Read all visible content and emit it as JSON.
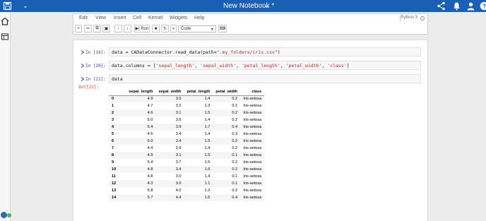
{
  "topbar": {
    "title": "New Notebook *",
    "bg_color": "#1b5fb4"
  },
  "menu": {
    "items": [
      "Edit",
      "View",
      "Insert",
      "Cell",
      "Kernel",
      "Widgets",
      "Help"
    ],
    "kernel": "Python 3"
  },
  "toolbar": {
    "run_label": "Run",
    "cell_type": "Code",
    "icons": [
      "add-cell-icon",
      "cut-icon",
      "copy-icon",
      "paste-icon",
      "move-up-icon",
      "move-down-icon",
      "run-icon",
      "stop-icon",
      "restart-icon",
      "fast-forward-icon",
      "keyboard-icon"
    ]
  },
  "cells": [
    {
      "prompt": "In [16]:",
      "code_parts": [
        "data = CADataConnector.read_data(path=",
        "\".my_folders/iris.csv\"",
        ")"
      ]
    },
    {
      "prompt": "In [20]:",
      "code_parts": [
        "data.columns = [",
        "'sepal_length'",
        ", ",
        "'sepal_width'",
        ", ",
        "'petal_length'",
        ", ",
        "'petal_width'",
        ", ",
        "'class'",
        "]"
      ]
    },
    {
      "prompt": "In [21]:",
      "code_parts": [
        "data"
      ]
    }
  ],
  "output": {
    "prompt": "Out[21]:",
    "columns": [
      "sepal_length",
      "sepal_width",
      "petal_length",
      "petal_width",
      "class"
    ],
    "rows": [
      [
        "0",
        "4.9",
        "3.0",
        "1.4",
        "0.2",
        "Iris-setosa"
      ],
      [
        "1",
        "4.7",
        "3.2",
        "1.3",
        "0.2",
        "Iris-setosa"
      ],
      [
        "2",
        "4.6",
        "3.1",
        "1.5",
        "0.2",
        "Iris-setosa"
      ],
      [
        "3",
        "5.0",
        "3.6",
        "1.4",
        "0.2",
        "Iris-setosa"
      ],
      [
        "4",
        "5.4",
        "3.9",
        "1.7",
        "0.4",
        "Iris-setosa"
      ],
      [
        "5",
        "4.6",
        "3.4",
        "1.4",
        "0.3",
        "Iris-setosa"
      ],
      [
        "6",
        "5.0",
        "3.4",
        "1.5",
        "0.2",
        "Iris-setosa"
      ],
      [
        "7",
        "4.4",
        "2.9",
        "1.4",
        "0.2",
        "Iris-setosa"
      ],
      [
        "8",
        "4.9",
        "3.1",
        "1.5",
        "0.1",
        "Iris-setosa"
      ],
      [
        "9",
        "5.4",
        "3.7",
        "1.5",
        "0.2",
        "Iris-setosa"
      ],
      [
        "10",
        "4.8",
        "3.4",
        "1.6",
        "0.2",
        "Iris-setosa"
      ],
      [
        "11",
        "4.8",
        "3.0",
        "1.4",
        "0.1",
        "Iris-setosa"
      ],
      [
        "12",
        "4.3",
        "3.0",
        "1.1",
        "0.1",
        "Iris-setosa"
      ],
      [
        "13",
        "5.8",
        "4.0",
        "1.2",
        "0.2",
        "Iris-setosa"
      ],
      [
        "14",
        "5.7",
        "4.4",
        "1.5",
        "0.4",
        "Iris-setosa"
      ]
    ]
  }
}
